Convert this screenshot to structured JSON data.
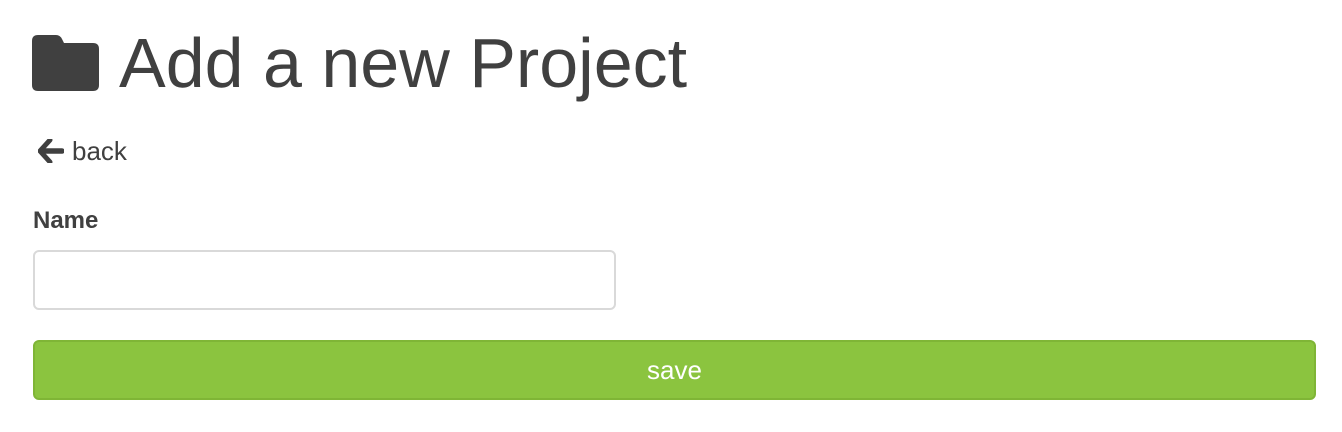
{
  "header": {
    "icon": "folder-icon",
    "title": "Add a new Project"
  },
  "nav": {
    "back_icon": "arrow-left-icon",
    "back_label": "back"
  },
  "form": {
    "name_label": "Name",
    "name_value": "",
    "name_placeholder": "",
    "save_label": "save"
  },
  "colors": {
    "text": "#404040",
    "accent": "#8bc43f",
    "input_border": "#d9d9d9"
  }
}
